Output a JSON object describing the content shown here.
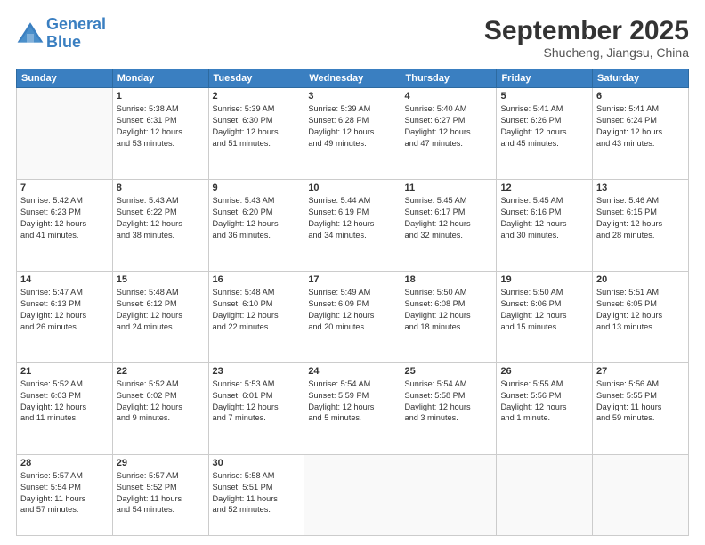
{
  "header": {
    "logo_line1": "General",
    "logo_line2": "Blue",
    "month": "September 2025",
    "location": "Shucheng, Jiangsu, China"
  },
  "days_of_week": [
    "Sunday",
    "Monday",
    "Tuesday",
    "Wednesday",
    "Thursday",
    "Friday",
    "Saturday"
  ],
  "weeks": [
    [
      {
        "day": "",
        "info": ""
      },
      {
        "day": "1",
        "info": "Sunrise: 5:38 AM\nSunset: 6:31 PM\nDaylight: 12 hours\nand 53 minutes."
      },
      {
        "day": "2",
        "info": "Sunrise: 5:39 AM\nSunset: 6:30 PM\nDaylight: 12 hours\nand 51 minutes."
      },
      {
        "day": "3",
        "info": "Sunrise: 5:39 AM\nSunset: 6:28 PM\nDaylight: 12 hours\nand 49 minutes."
      },
      {
        "day": "4",
        "info": "Sunrise: 5:40 AM\nSunset: 6:27 PM\nDaylight: 12 hours\nand 47 minutes."
      },
      {
        "day": "5",
        "info": "Sunrise: 5:41 AM\nSunset: 6:26 PM\nDaylight: 12 hours\nand 45 minutes."
      },
      {
        "day": "6",
        "info": "Sunrise: 5:41 AM\nSunset: 6:24 PM\nDaylight: 12 hours\nand 43 minutes."
      }
    ],
    [
      {
        "day": "7",
        "info": "Sunrise: 5:42 AM\nSunset: 6:23 PM\nDaylight: 12 hours\nand 41 minutes."
      },
      {
        "day": "8",
        "info": "Sunrise: 5:43 AM\nSunset: 6:22 PM\nDaylight: 12 hours\nand 38 minutes."
      },
      {
        "day": "9",
        "info": "Sunrise: 5:43 AM\nSunset: 6:20 PM\nDaylight: 12 hours\nand 36 minutes."
      },
      {
        "day": "10",
        "info": "Sunrise: 5:44 AM\nSunset: 6:19 PM\nDaylight: 12 hours\nand 34 minutes."
      },
      {
        "day": "11",
        "info": "Sunrise: 5:45 AM\nSunset: 6:17 PM\nDaylight: 12 hours\nand 32 minutes."
      },
      {
        "day": "12",
        "info": "Sunrise: 5:45 AM\nSunset: 6:16 PM\nDaylight: 12 hours\nand 30 minutes."
      },
      {
        "day": "13",
        "info": "Sunrise: 5:46 AM\nSunset: 6:15 PM\nDaylight: 12 hours\nand 28 minutes."
      }
    ],
    [
      {
        "day": "14",
        "info": "Sunrise: 5:47 AM\nSunset: 6:13 PM\nDaylight: 12 hours\nand 26 minutes."
      },
      {
        "day": "15",
        "info": "Sunrise: 5:48 AM\nSunset: 6:12 PM\nDaylight: 12 hours\nand 24 minutes."
      },
      {
        "day": "16",
        "info": "Sunrise: 5:48 AM\nSunset: 6:10 PM\nDaylight: 12 hours\nand 22 minutes."
      },
      {
        "day": "17",
        "info": "Sunrise: 5:49 AM\nSunset: 6:09 PM\nDaylight: 12 hours\nand 20 minutes."
      },
      {
        "day": "18",
        "info": "Sunrise: 5:50 AM\nSunset: 6:08 PM\nDaylight: 12 hours\nand 18 minutes."
      },
      {
        "day": "19",
        "info": "Sunrise: 5:50 AM\nSunset: 6:06 PM\nDaylight: 12 hours\nand 15 minutes."
      },
      {
        "day": "20",
        "info": "Sunrise: 5:51 AM\nSunset: 6:05 PM\nDaylight: 12 hours\nand 13 minutes."
      }
    ],
    [
      {
        "day": "21",
        "info": "Sunrise: 5:52 AM\nSunset: 6:03 PM\nDaylight: 12 hours\nand 11 minutes."
      },
      {
        "day": "22",
        "info": "Sunrise: 5:52 AM\nSunset: 6:02 PM\nDaylight: 12 hours\nand 9 minutes."
      },
      {
        "day": "23",
        "info": "Sunrise: 5:53 AM\nSunset: 6:01 PM\nDaylight: 12 hours\nand 7 minutes."
      },
      {
        "day": "24",
        "info": "Sunrise: 5:54 AM\nSunset: 5:59 PM\nDaylight: 12 hours\nand 5 minutes."
      },
      {
        "day": "25",
        "info": "Sunrise: 5:54 AM\nSunset: 5:58 PM\nDaylight: 12 hours\nand 3 minutes."
      },
      {
        "day": "26",
        "info": "Sunrise: 5:55 AM\nSunset: 5:56 PM\nDaylight: 12 hours\nand 1 minute."
      },
      {
        "day": "27",
        "info": "Sunrise: 5:56 AM\nSunset: 5:55 PM\nDaylight: 11 hours\nand 59 minutes."
      }
    ],
    [
      {
        "day": "28",
        "info": "Sunrise: 5:57 AM\nSunset: 5:54 PM\nDaylight: 11 hours\nand 57 minutes."
      },
      {
        "day": "29",
        "info": "Sunrise: 5:57 AM\nSunset: 5:52 PM\nDaylight: 11 hours\nand 54 minutes."
      },
      {
        "day": "30",
        "info": "Sunrise: 5:58 AM\nSunset: 5:51 PM\nDaylight: 11 hours\nand 52 minutes."
      },
      {
        "day": "",
        "info": ""
      },
      {
        "day": "",
        "info": ""
      },
      {
        "day": "",
        "info": ""
      },
      {
        "day": "",
        "info": ""
      }
    ]
  ]
}
